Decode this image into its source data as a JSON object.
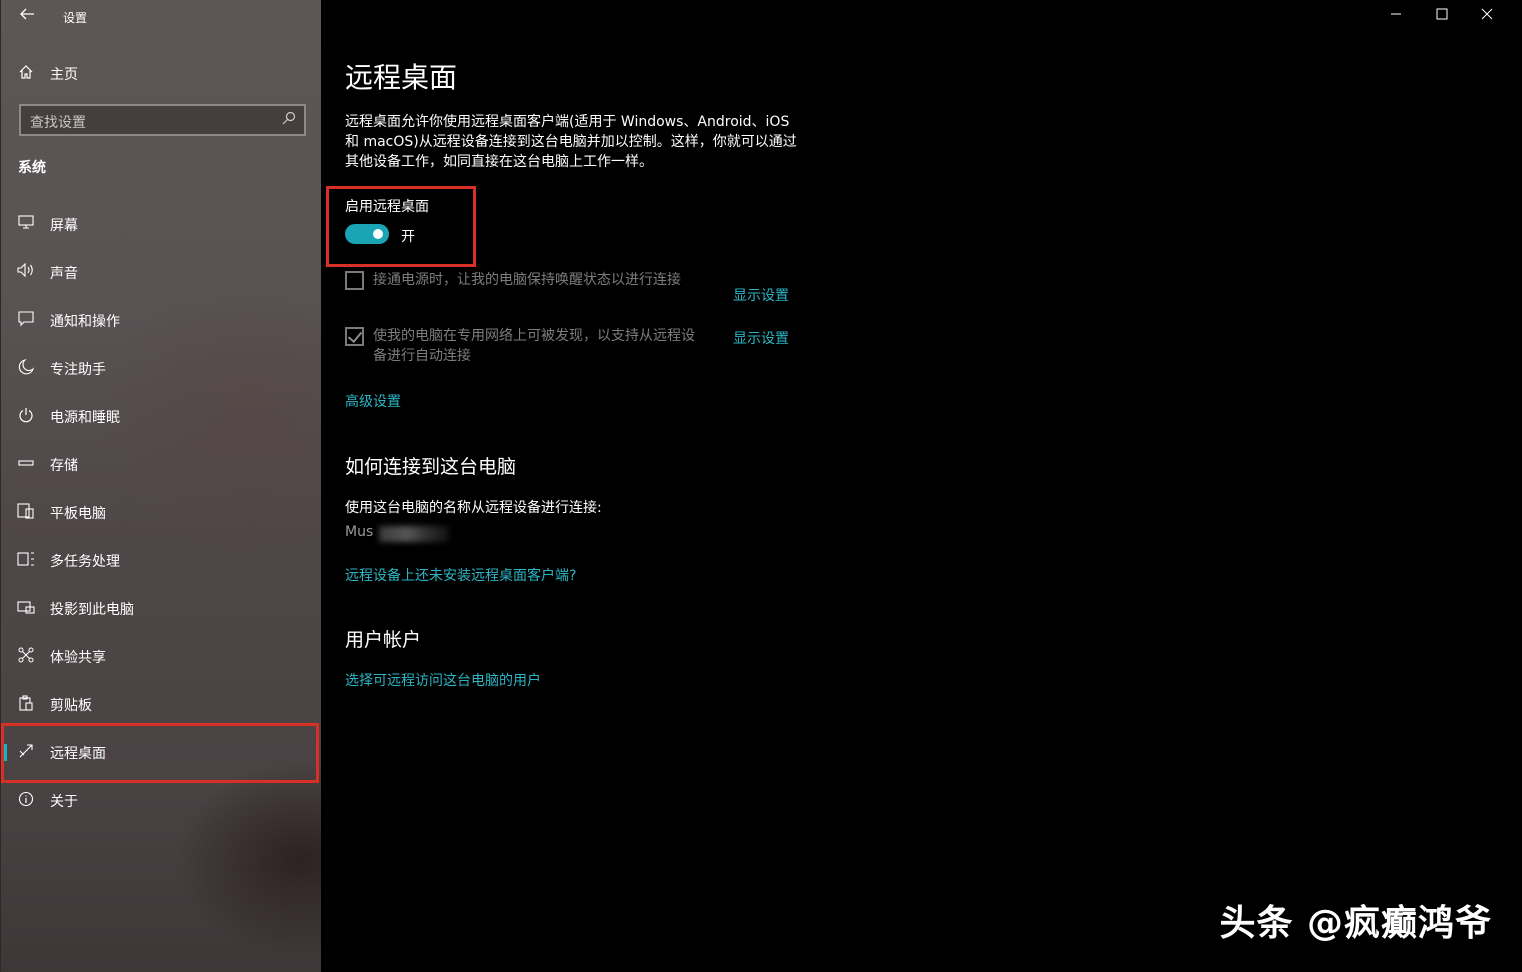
{
  "app": {
    "title": "设置",
    "back_icon": "back-arrow-icon"
  },
  "sidebar": {
    "home_label": "主页",
    "search_placeholder": "查找设置",
    "section": "系统",
    "items": [
      {
        "label": "屏幕",
        "icon": "monitor-icon"
      },
      {
        "label": "声音",
        "icon": "speaker-icon"
      },
      {
        "label": "通知和操作",
        "icon": "message-icon"
      },
      {
        "label": "专注助手",
        "icon": "moon-icon"
      },
      {
        "label": "电源和睡眠",
        "icon": "power-icon"
      },
      {
        "label": "存储",
        "icon": "storage-icon"
      },
      {
        "label": "平板电脑",
        "icon": "tablet-icon"
      },
      {
        "label": "多任务处理",
        "icon": "multitask-icon"
      },
      {
        "label": "投影到此电脑",
        "icon": "project-icon"
      },
      {
        "label": "体验共享",
        "icon": "share-icon"
      },
      {
        "label": "剪贴板",
        "icon": "clipboard-icon"
      },
      {
        "label": "远程桌面",
        "icon": "remote-desktop-icon",
        "active": true
      },
      {
        "label": "关于",
        "icon": "info-icon"
      }
    ]
  },
  "window_controls": {
    "minimize": "minimize-icon",
    "maximize": "maximize-icon",
    "close": "close-icon"
  },
  "main": {
    "title": "远程桌面",
    "description": "远程桌面允许你使用远程桌面客户端(适用于 Windows、Android、iOS 和 macOS)从远程设备连接到这台电脑并加以控制。这样，你就可以通过其他设备工作，如同直接在这台电脑上工作一样。",
    "enable_label": "启用远程桌面",
    "toggle_state": "开",
    "toggle_on": true,
    "option1_text": "接通电源时，让我的电脑保持唤醒状态以进行连接",
    "option1_checked": false,
    "option1_link": "显示设置",
    "option2_text_line1": "使我的电脑在专用网络上可被发现，以支持从远程设",
    "option2_text_line2": "备进行自动连接",
    "option2_checked": true,
    "option2_link": "显示设置",
    "advanced_link": "高级设置",
    "how_heading": "如何连接到这台电脑",
    "how_text": "使用这台电脑的名称从远程设备进行连接:",
    "pc_name": "Mus",
    "client_link": "远程设备上还未安装远程桌面客户端?",
    "accounts_heading": "用户帐户",
    "accounts_link": "选择可远程访问这台电脑的用户"
  },
  "watermark": "头条 @疯癫鸿爷",
  "colors": {
    "accent": "#1aa5b5",
    "link": "#2cb5c5",
    "highlight_box": "#d93025"
  }
}
